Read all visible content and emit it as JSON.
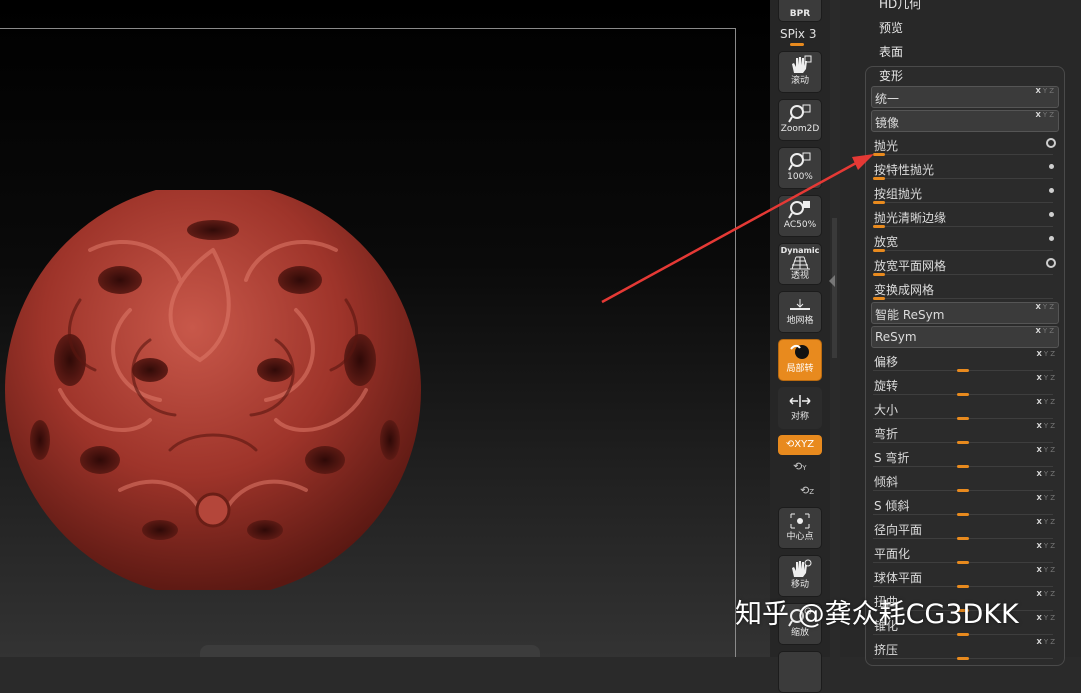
{
  "toolbar": {
    "bpr_label": "BPR",
    "spix_label": "SPix 3",
    "buttons": [
      {
        "label": "滚动"
      },
      {
        "label": "Zoom2D"
      },
      {
        "label": "100%"
      },
      {
        "label": "AC50%"
      },
      {
        "label": "透视",
        "top": "Dynamic"
      },
      {
        "label": "地网格"
      },
      {
        "label": "局部转"
      },
      {
        "label": "对称"
      },
      {
        "label": "中心点"
      },
      {
        "label": "移动"
      },
      {
        "label": "缩放"
      }
    ],
    "xyz_label": "XYZ",
    "y_label": "Y",
    "z_label": "Z"
  },
  "panel": {
    "menu": [
      "HD几何",
      "预览",
      "表面",
      "变形"
    ],
    "rows": [
      {
        "label": "统一",
        "kind": "button",
        "xyz": true
      },
      {
        "label": "镜像",
        "kind": "button",
        "xyz": true
      },
      {
        "label": "抛光",
        "kind": "slider",
        "marker": "ring",
        "value": 0
      },
      {
        "label": "按特性抛光",
        "kind": "slider",
        "marker": "dot",
        "value": 0
      },
      {
        "label": "按组抛光",
        "kind": "slider",
        "marker": "dot",
        "value": 0
      },
      {
        "label": "抛光清晰边缘",
        "kind": "slider",
        "marker": "dot",
        "value": 0
      },
      {
        "label": "放宽",
        "kind": "slider",
        "marker": "dot",
        "value": 0
      },
      {
        "label": "放宽平面网格",
        "kind": "slider",
        "marker": "ring",
        "value": 0
      },
      {
        "label": "变换成网格",
        "kind": "slider",
        "value": 0
      },
      {
        "label": "智能 ReSym",
        "kind": "button",
        "xyz": true
      },
      {
        "label": "ReSym",
        "kind": "button",
        "xyz": true
      },
      {
        "label": "偏移",
        "kind": "slider",
        "xyz": true,
        "value": 50
      },
      {
        "label": "旋转",
        "kind": "slider",
        "xyz": true,
        "value": 50
      },
      {
        "label": "大小",
        "kind": "slider",
        "xyz": true,
        "value": 50
      },
      {
        "label": "弯折",
        "kind": "slider",
        "xyz": true,
        "value": 50
      },
      {
        "label": "S 弯折",
        "kind": "slider",
        "xyz": true,
        "value": 50
      },
      {
        "label": "倾斜",
        "kind": "slider",
        "xyz": true,
        "value": 50
      },
      {
        "label": "S 倾斜",
        "kind": "slider",
        "xyz": true,
        "value": 50
      },
      {
        "label": "径向平面",
        "kind": "slider",
        "xyz": true,
        "value": 50
      },
      {
        "label": "平面化",
        "kind": "slider",
        "xyz": true,
        "value": 50
      },
      {
        "label": "球体平面",
        "kind": "slider",
        "xyz": true,
        "value": 50
      },
      {
        "label": "扭曲",
        "kind": "slider",
        "xyz": true,
        "value": 50
      },
      {
        "label": "锥化",
        "kind": "slider",
        "xyz": true,
        "value": 50
      },
      {
        "label": "挤压",
        "kind": "slider",
        "xyz": true,
        "value": 50
      }
    ]
  },
  "xyz_text": {
    "x": "X",
    "y": "Y",
    "z": "Z"
  },
  "watermark": "知乎 @龚众耗CG3DKK",
  "colors": {
    "accent": "#e88a1e",
    "annotation_arrow": "#e53935",
    "model": "#a8382e"
  }
}
